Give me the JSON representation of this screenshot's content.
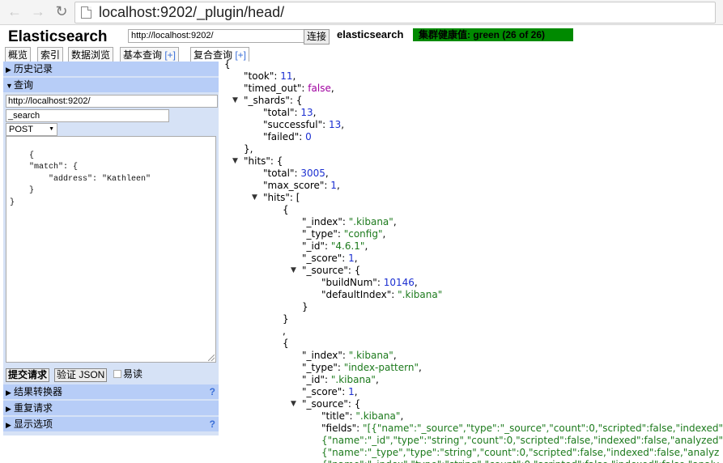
{
  "browser": {
    "url": "localhost:9202/_plugin/head/",
    "back_icon": "arrow-left-icon",
    "forward_icon": "arrow-right-icon",
    "reload_icon": "reload-icon",
    "page_icon": "page-icon"
  },
  "header": {
    "title": "Elasticsearch",
    "connect_url": "http://localhost:9202/",
    "connect_button": "连接",
    "cluster_name": "elasticsearch",
    "health": "集群健康值: green (26 of 26)",
    "health_color": "#008a00"
  },
  "tabs": [
    {
      "label": "概览",
      "plus": ""
    },
    {
      "label": "索引",
      "plus": ""
    },
    {
      "label": "数据浏览",
      "plus": ""
    },
    {
      "label": "基本查询 ",
      "plus": "[+]"
    },
    {
      "label": "复合查询 ",
      "plus": "[+]"
    }
  ],
  "left": {
    "history_label": "历史记录",
    "query_label": "查询",
    "query_url": "http://localhost:9202/",
    "query_path": "_search",
    "method": "POST",
    "body_text": "{\n    \"match\": {\n        \"address\": \"Kathleen\"\n    }\n}",
    "submit_button": "提交请求",
    "validate_button": "验证 JSON",
    "easy_read_label": "易读",
    "transformer_label": "结果转换器",
    "repeat_label": "重复请求",
    "display_label": "显示选项",
    "help_mark": "?"
  },
  "result": {
    "lines": [
      {
        "indent": 0,
        "tri": "",
        "parts": [
          {
            "c": "k",
            "t": "{"
          }
        ]
      },
      {
        "indent": 1,
        "tri": "",
        "parts": [
          {
            "c": "k",
            "t": "\"took\": "
          },
          {
            "c": "n",
            "t": "11"
          },
          {
            "c": "k",
            "t": ","
          }
        ]
      },
      {
        "indent": 1,
        "tri": "",
        "parts": [
          {
            "c": "k",
            "t": "\"timed_out\": "
          },
          {
            "c": "b",
            "t": "false"
          },
          {
            "c": "k",
            "t": ","
          }
        ]
      },
      {
        "indent": 1,
        "tri": "▼",
        "parts": [
          {
            "c": "k",
            "t": "\"_shards\": {"
          }
        ]
      },
      {
        "indent": 2,
        "tri": "",
        "parts": [
          {
            "c": "k",
            "t": "\"total\": "
          },
          {
            "c": "n",
            "t": "13"
          },
          {
            "c": "k",
            "t": ","
          }
        ]
      },
      {
        "indent": 2,
        "tri": "",
        "parts": [
          {
            "c": "k",
            "t": "\"successful\": "
          },
          {
            "c": "n",
            "t": "13"
          },
          {
            "c": "k",
            "t": ","
          }
        ]
      },
      {
        "indent": 2,
        "tri": "",
        "parts": [
          {
            "c": "k",
            "t": "\"failed\": "
          },
          {
            "c": "n",
            "t": "0"
          }
        ]
      },
      {
        "indent": 1,
        "tri": "",
        "parts": [
          {
            "c": "k",
            "t": "},"
          }
        ]
      },
      {
        "indent": 1,
        "tri": "▼",
        "parts": [
          {
            "c": "k",
            "t": "\"hits\": {"
          }
        ]
      },
      {
        "indent": 2,
        "tri": "",
        "parts": [
          {
            "c": "k",
            "t": "\"total\": "
          },
          {
            "c": "n",
            "t": "3005"
          },
          {
            "c": "k",
            "t": ","
          }
        ]
      },
      {
        "indent": 2,
        "tri": "",
        "parts": [
          {
            "c": "k",
            "t": "\"max_score\": "
          },
          {
            "c": "n",
            "t": "1"
          },
          {
            "c": "k",
            "t": ","
          }
        ]
      },
      {
        "indent": 2,
        "tri": "▼",
        "parts": [
          {
            "c": "k",
            "t": "\"hits\": ["
          }
        ]
      },
      {
        "indent": 3,
        "tri": "",
        "parts": [
          {
            "c": "k",
            "t": "{"
          }
        ]
      },
      {
        "indent": 4,
        "tri": "",
        "parts": [
          {
            "c": "k",
            "t": "\"_index\": "
          },
          {
            "c": "s",
            "t": "\".kibana\""
          },
          {
            "c": "k",
            "t": ","
          }
        ]
      },
      {
        "indent": 4,
        "tri": "",
        "parts": [
          {
            "c": "k",
            "t": "\"_type\": "
          },
          {
            "c": "s",
            "t": "\"config\""
          },
          {
            "c": "k",
            "t": ","
          }
        ]
      },
      {
        "indent": 4,
        "tri": "",
        "parts": [
          {
            "c": "k",
            "t": "\"_id\": "
          },
          {
            "c": "s",
            "t": "\"4.6.1\""
          },
          {
            "c": "k",
            "t": ","
          }
        ]
      },
      {
        "indent": 4,
        "tri": "",
        "parts": [
          {
            "c": "k",
            "t": "\"_score\": "
          },
          {
            "c": "n",
            "t": "1"
          },
          {
            "c": "k",
            "t": ","
          }
        ]
      },
      {
        "indent": 4,
        "tri": "▼",
        "parts": [
          {
            "c": "k",
            "t": "\"_source\": {"
          }
        ]
      },
      {
        "indent": 5,
        "tri": "",
        "parts": [
          {
            "c": "k",
            "t": "\"buildNum\": "
          },
          {
            "c": "n",
            "t": "10146"
          },
          {
            "c": "k",
            "t": ","
          }
        ]
      },
      {
        "indent": 5,
        "tri": "",
        "parts": [
          {
            "c": "k",
            "t": "\"defaultIndex\": "
          },
          {
            "c": "s",
            "t": "\".kibana\""
          }
        ]
      },
      {
        "indent": 4,
        "tri": "",
        "parts": [
          {
            "c": "k",
            "t": "}"
          }
        ]
      },
      {
        "indent": 3,
        "tri": "",
        "parts": [
          {
            "c": "k",
            "t": "}"
          }
        ]
      },
      {
        "indent": 3,
        "tri": "",
        "parts": [
          {
            "c": "k",
            "t": ","
          }
        ]
      },
      {
        "indent": 3,
        "tri": "",
        "parts": [
          {
            "c": "k",
            "t": "{"
          }
        ]
      },
      {
        "indent": 4,
        "tri": "",
        "parts": [
          {
            "c": "k",
            "t": "\"_index\": "
          },
          {
            "c": "s",
            "t": "\".kibana\""
          },
          {
            "c": "k",
            "t": ","
          }
        ]
      },
      {
        "indent": 4,
        "tri": "",
        "parts": [
          {
            "c": "k",
            "t": "\"_type\": "
          },
          {
            "c": "s",
            "t": "\"index-pattern\""
          },
          {
            "c": "k",
            "t": ","
          }
        ]
      },
      {
        "indent": 4,
        "tri": "",
        "parts": [
          {
            "c": "k",
            "t": "\"_id\": "
          },
          {
            "c": "s",
            "t": "\".kibana\""
          },
          {
            "c": "k",
            "t": ","
          }
        ]
      },
      {
        "indent": 4,
        "tri": "",
        "parts": [
          {
            "c": "k",
            "t": "\"_score\": "
          },
          {
            "c": "n",
            "t": "1"
          },
          {
            "c": "k",
            "t": ","
          }
        ]
      },
      {
        "indent": 4,
        "tri": "▼",
        "parts": [
          {
            "c": "k",
            "t": "\"_source\": {"
          }
        ]
      },
      {
        "indent": 5,
        "tri": "",
        "parts": [
          {
            "c": "k",
            "t": "\"title\": "
          },
          {
            "c": "s",
            "t": "\".kibana\""
          },
          {
            "c": "k",
            "t": ","
          }
        ]
      },
      {
        "indent": 5,
        "tri": "",
        "parts": [
          {
            "c": "k",
            "t": "\"fields\": "
          },
          {
            "c": "s",
            "t": "\"[{\"name\":\"_source\",\"type\":\"_source\",\"count\":0,\"scripted\":false,\"indexed\""
          }
        ]
      },
      {
        "indent": 5,
        "tri": "",
        "parts": [
          {
            "c": "s",
            "t": "{\"name\":\"_id\",\"type\":\"string\",\"count\":0,\"scripted\":false,\"indexed\":false,\"analyzed\""
          }
        ]
      },
      {
        "indent": 5,
        "tri": "",
        "parts": [
          {
            "c": "s",
            "t": "{\"name\":\"_type\",\"type\":\"string\",\"count\":0,\"scripted\":false,\"indexed\":false,\"analyz"
          }
        ]
      },
      {
        "indent": 5,
        "tri": "",
        "parts": [
          {
            "c": "s",
            "t": "{\"name\":\"_index\",\"type\":\"string\",\"count\":0,\"scripted\":false,\"indexed\":false,\"analy"
          }
        ]
      }
    ]
  }
}
